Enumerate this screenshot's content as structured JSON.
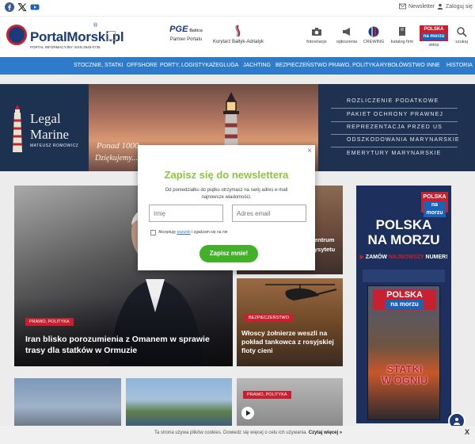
{
  "topbar": {
    "social": [
      "facebook-icon",
      "x-icon",
      "youtube-icon"
    ],
    "newsletter_label": "Newsletter",
    "login_label": "Zaloguj się"
  },
  "header": {
    "logo_text": "PortalMorski.pl",
    "logo_reg": "®",
    "logo_sub": "PORTAL INFORMACYJNY ISSN 2545-0735",
    "partner_label": "Partner Portalu",
    "partner_brand": "PGE",
    "partner_brand_sub": "Baltica",
    "sponsor_label": "Korytarz Bałtyk-Adriatyk",
    "icons": [
      {
        "name": "camera-icon",
        "label": "fotorelacje"
      },
      {
        "name": "megaphone-icon",
        "label": "ogłoszenia"
      },
      {
        "name": "crewing-icon",
        "label": "CREWING"
      },
      {
        "name": "book-icon",
        "label": "katalog firm"
      },
      {
        "name": "shop-icon",
        "label": "sklep"
      },
      {
        "name": "search-icon",
        "label": "szukaj"
      }
    ],
    "shop_logo_line1": "POLSKA",
    "shop_logo_line2": "na morzu"
  },
  "nav": {
    "items": [
      "STOCZNIE, STATKI",
      "OFFSHORE",
      "PORTY, LOGISTYKA",
      "ŻEGLUGA",
      "JACHTING",
      "BEZPIECZEŃSTWO",
      "PRAWO, POLITYKA",
      "RYBOŁÓWSTWO",
      "INNE",
      "HISTORIA"
    ]
  },
  "banner": {
    "brand_line1": "Legal",
    "brand_line2": "Marine",
    "brand_sub": "MATEUSZ ROMOWICZ",
    "photo_text_1": "Ponad 1000...",
    "photo_text_2": "Dziękujemy...",
    "services": [
      "ROZLICZENIE PODATKOWE",
      "PAKIET OCHRONY PRAWNEJ",
      "REPREZENTACJA PRZED US",
      "ODSZKODOWANIA MARYNARSKIE",
      "EMERYTURY MARYNARSKIE"
    ]
  },
  "main": {
    "featured": {
      "tag": "PRAWO, POLITYKA",
      "title": "Iran blisko porozumienia z Omanem w sprawie trasy dla statków w Ormuzie"
    },
    "side_top": {
      "title_fragment_1": "entrum",
      "title_fragment_2": "ysytetu"
    },
    "side_bottom": {
      "tag": "BEZPIECZEŃSTWO",
      "title": "Włoscy żołnierze weszli na pokład tankowca z rosyjskiej floty cieni"
    },
    "bottom_card_tag": "PRAWO, POLITYKA"
  },
  "ad": {
    "badge_line1": "POLSKA",
    "badge_line2": "na morzu",
    "headline_1": "POLSKA",
    "headline_2": "NA MORZU",
    "cta_1": "ZAMÓW",
    "cta_2": "NAJNOWSZY",
    "cta_3": "NUMER!",
    "mag_title_1": "POLSKA",
    "mag_title_2": "na morzu",
    "mag_headline_1": "STATKI",
    "mag_headline_2": "W OGNIU"
  },
  "modal": {
    "title": "Zapisz się do newslettera",
    "description": "Od poniedziałku do piątku otrzymasz na swój adres e-mail najnowsze wiadomości.",
    "name_placeholder": "Imię",
    "email_placeholder": "Adres email",
    "consent_prefix": "Akceptuję",
    "consent_link": "warunki",
    "consent_suffix": "i zgadzam się na nie",
    "submit_label": "Zapisz mnie!",
    "close_label": "×"
  },
  "cookie": {
    "text": "Ta strona używa plików cookies. Dowiedz się więcej o celu ich używania.",
    "link": "Czytaj więcej »",
    "close": "X"
  },
  "colors": {
    "nav": "#2f7bcb",
    "brand_navy": "#1a3a7a",
    "accent_red": "#c8202e",
    "modal_title": "#8cc63f",
    "modal_button": "#43b02a"
  }
}
